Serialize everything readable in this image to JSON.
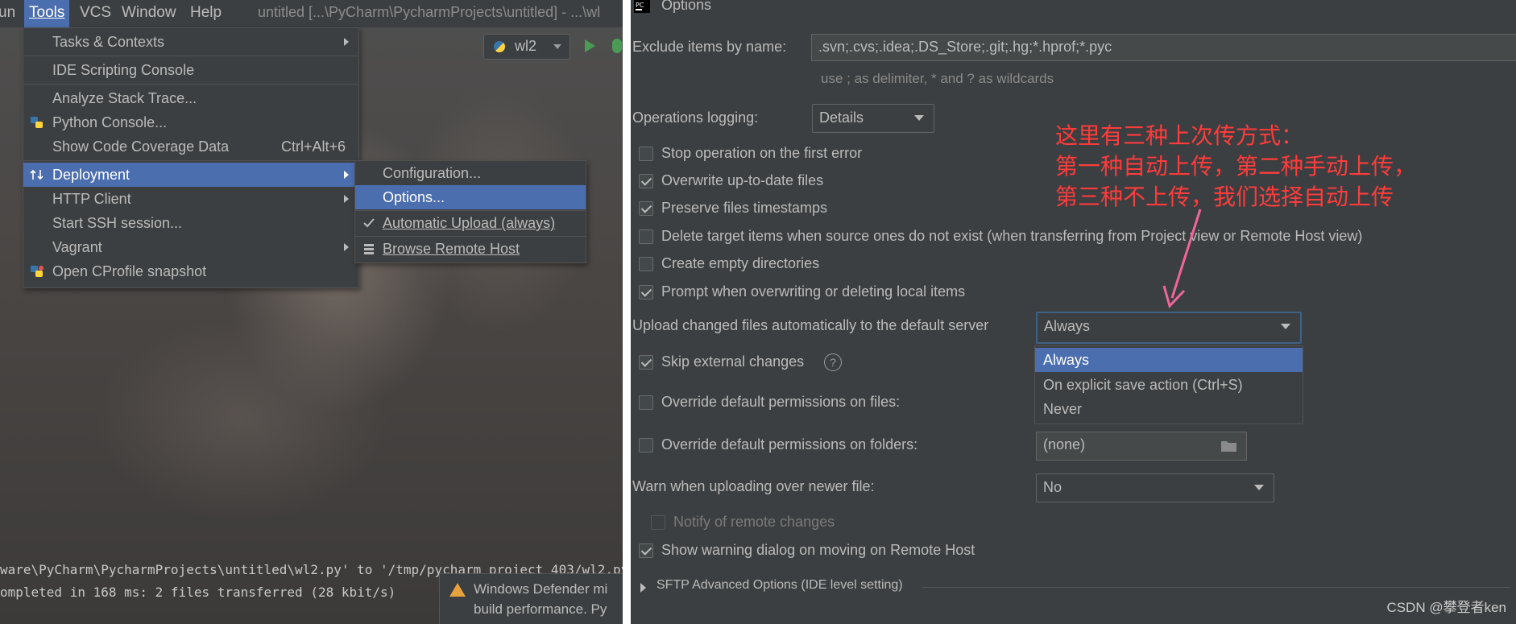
{
  "menubar": {
    "items": [
      "un",
      "Tools",
      "VCS",
      "Window",
      "Help"
    ],
    "title": "untitled [...\\PyCharm\\PycharmProjects\\untitled] - ...\\wl"
  },
  "run_config": {
    "name": "wl2"
  },
  "tools_menu": {
    "items": [
      {
        "label": "Tasks & Contexts",
        "submenu": true
      },
      {
        "label": "IDE Scripting Console"
      },
      {
        "label": "Analyze Stack Trace..."
      },
      {
        "label": "Python Console...",
        "icon": "python-icon"
      },
      {
        "label": "Show Code Coverage Data",
        "shortcut": "Ctrl+Alt+6"
      },
      {
        "label": "Deployment",
        "submenu": true,
        "selected": true,
        "icon": "deployment-icon"
      },
      {
        "label": "HTTP Client",
        "submenu": true
      },
      {
        "label": "Start SSH session..."
      },
      {
        "label": "Vagrant",
        "submenu": true
      },
      {
        "label": "Open CProfile snapshot",
        "icon": "cprofile-icon"
      }
    ]
  },
  "deployment_menu": {
    "items": [
      {
        "label": "Configuration..."
      },
      {
        "label": "Options...",
        "selected": true
      },
      {
        "label": "Automatic Upload (always)",
        "checked": true
      },
      {
        "label": "Browse Remote Host",
        "icon": "server-icon"
      }
    ]
  },
  "log": {
    "line1": "ware\\PyCharm\\PycharmProjects\\untitled\\wl2.py' to '/tmp/pycharm_project_403/wl2.py",
    "line2": "ompleted in 168 ms: 2 files transferred (28 kbit/s)"
  },
  "defender": {
    "line1": "Windows Defender mi",
    "line2": "build performance. Py"
  },
  "options": {
    "title": "Options",
    "exclude_label": "Exclude items by name:",
    "exclude_value": ".svn;.cvs;.idea;.DS_Store;.git;.hg;*.hprof;*.pyc",
    "exclude_hint": "use ; as delimiter, * and ? as wildcards",
    "logging_label": "Operations logging:",
    "logging_value": "Details",
    "checkboxes": [
      {
        "label": "Stop operation on the first error",
        "checked": false
      },
      {
        "label": "Overwrite up-to-date files",
        "checked": true
      },
      {
        "label": "Preserve files timestamps",
        "checked": true
      },
      {
        "label": "Delete target items when source ones do not exist (when transferring from Project view or Remote Host view)",
        "checked": false
      },
      {
        "label": "Create empty directories",
        "checked": false
      },
      {
        "label": "Prompt when overwriting or deleting local items",
        "checked": true
      }
    ],
    "upload_label": "Upload changed files automatically to the default server",
    "upload_value": "Always",
    "upload_options": [
      "Always",
      "On explicit save action (Ctrl+S)",
      "Never"
    ],
    "skip_external": "Skip external changes",
    "help_glyph": "?",
    "override_files": "Override default permissions on files:",
    "override_folders": "Override default permissions on folders:",
    "folders_value": "(none)",
    "warn_label": "Warn when uploading over newer file:",
    "warn_value": "No",
    "notify_remote": "Notify of remote changes",
    "show_warning": "Show warning dialog on moving on Remote Host",
    "sftp_label": "SFTP Advanced Options (IDE level setting)"
  },
  "annotation": {
    "line1": "这里有三种上次传方式：",
    "line2": "第一种自动上传，第二种手动上传，",
    "line3": "第三种不上传，我们选择自动上传"
  },
  "watermark": "CSDN @攀登者ken",
  "colors": {
    "accent": "#4b6eaf",
    "annotation": "#ff3b3b",
    "arrow": "#f0669a"
  }
}
